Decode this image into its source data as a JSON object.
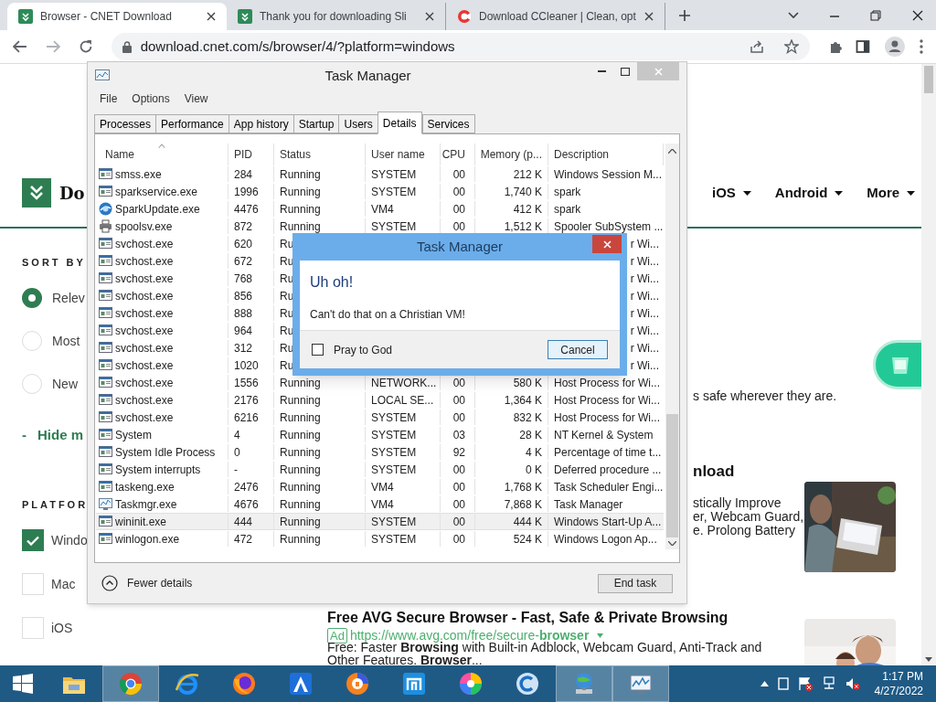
{
  "browser": {
    "tabs": [
      {
        "title": "Browser - CNET Download",
        "kind": "cnet",
        "selected": true
      },
      {
        "title": "Thank you for downloading Sli",
        "kind": "cnet",
        "selected": false
      },
      {
        "title": "Download CCleaner | Clean, opt",
        "kind": "ccleaner",
        "selected": false
      }
    ],
    "url": "download.cnet.com/s/browser/4/?platform=windows"
  },
  "page": {
    "logo_text": "Do",
    "nav": [
      "iOS",
      "Android",
      "More"
    ],
    "sort_by": {
      "heading": "SORT BY",
      "options": [
        {
          "label": "Relev",
          "selected": true
        },
        {
          "label": "Most",
          "selected": false
        },
        {
          "label": "New",
          "selected": false
        }
      ]
    },
    "toggle": {
      "sign": "-",
      "label": "Hide m"
    },
    "platform": {
      "heading": "PLATFOR",
      "options": [
        {
          "label": "Windo",
          "checked": true
        },
        {
          "label": "Mac",
          "checked": false
        },
        {
          "label": "iOS",
          "checked": false
        }
      ]
    },
    "intro_tail": "s safe wherever they are.",
    "result_1": {
      "title": "nload",
      "lines": [
        "stically Improve",
        "er, Webcam Guard,",
        "e. Prolong Battery"
      ]
    },
    "result_2": {
      "title": "Free AVG Secure Browser - Fast, Safe & Private Browsing",
      "ad_label": "Ad",
      "url": "https://www.avg.com/free/secure-**browser**",
      "description": "Free: Faster **Browsing** with Built-in Adblock, Webcam Guard, Anti-Track and Other Features. **Browser**..."
    }
  },
  "task_manager": {
    "title": "Task Manager",
    "menu": [
      "File",
      "Options",
      "View"
    ],
    "tabs": [
      {
        "label": "Processes",
        "selected": false
      },
      {
        "label": "Performance",
        "selected": false
      },
      {
        "label": "App history",
        "selected": false
      },
      {
        "label": "Startup",
        "selected": false
      },
      {
        "label": "Users",
        "selected": false
      },
      {
        "label": "Details",
        "selected": true
      },
      {
        "label": "Services",
        "selected": false
      }
    ],
    "columns": [
      {
        "label": "Name",
        "sorted": true
      },
      {
        "label": "PID",
        "sorted": false
      },
      {
        "label": "Status",
        "sorted": false
      },
      {
        "label": "User name",
        "sorted": false
      },
      {
        "label": "CPU",
        "sorted": false
      },
      {
        "label": "Memory (p...",
        "sorted": false
      },
      {
        "label": "Description",
        "sorted": false
      }
    ],
    "rows": [
      {
        "kind": "app",
        "name": "smss.exe",
        "pid": "284",
        "status": "Running",
        "user": "SYSTEM",
        "cpu": "00",
        "memory": "212 K",
        "description": "Windows Session M...",
        "selected": false
      },
      {
        "kind": "app",
        "name": "sparkservice.exe",
        "pid": "1996",
        "status": "Running",
        "user": "SYSTEM",
        "cpu": "00",
        "memory": "1,740 K",
        "description": "spark",
        "selected": false
      },
      {
        "kind": "update",
        "name": "SparkUpdate.exe",
        "pid": "4476",
        "status": "Running",
        "user": "VM4",
        "cpu": "00",
        "memory": "412 K",
        "description": "spark",
        "selected": false
      },
      {
        "kind": "printer",
        "name": "spoolsv.exe",
        "pid": "872",
        "status": "Running",
        "user": "SYSTEM",
        "cpu": "00",
        "memory": "1,512 K",
        "description": "Spooler SubSystem ...",
        "selected": false
      },
      {
        "kind": "app",
        "name": "svchost.exe",
        "pid": "620",
        "status": "Ru",
        "description": "r Wi...",
        "selected": false
      },
      {
        "kind": "app",
        "name": "svchost.exe",
        "pid": "672",
        "status": "Ru",
        "description": "r Wi...",
        "selected": false
      },
      {
        "kind": "app",
        "name": "svchost.exe",
        "pid": "768",
        "status": "Ru",
        "description": "r Wi...",
        "selected": false
      },
      {
        "kind": "app",
        "name": "svchost.exe",
        "pid": "856",
        "status": "Ru",
        "description": "r Wi...",
        "selected": false
      },
      {
        "kind": "app",
        "name": "svchost.exe",
        "pid": "888",
        "status": "Ru",
        "description": "r Wi...",
        "selected": false
      },
      {
        "kind": "app",
        "name": "svchost.exe",
        "pid": "964",
        "status": "Ru",
        "description": "r Wi...",
        "selected": false
      },
      {
        "kind": "app",
        "name": "svchost.exe",
        "pid": "312",
        "status": "Ru",
        "description": "r Wi...",
        "selected": false
      },
      {
        "kind": "app",
        "name": "svchost.exe",
        "pid": "1020",
        "status": "Ru",
        "description": "r Wi...",
        "selected": false
      },
      {
        "kind": "app",
        "name": "svchost.exe",
        "pid": "1556",
        "status": "Running",
        "user": "NETWORK...",
        "cpu": "00",
        "memory": "580 K",
        "description": "Host Process for Wi...",
        "selected": false
      },
      {
        "kind": "app",
        "name": "svchost.exe",
        "pid": "2176",
        "status": "Running",
        "user": "LOCAL SE...",
        "cpu": "00",
        "memory": "1,364 K",
        "description": "Host Process for Wi...",
        "selected": false
      },
      {
        "kind": "app",
        "name": "svchost.exe",
        "pid": "6216",
        "status": "Running",
        "user": "SYSTEM",
        "cpu": "00",
        "memory": "832 K",
        "description": "Host Process for Wi...",
        "selected": false
      },
      {
        "kind": "app",
        "name": "System",
        "pid": "4",
        "status": "Running",
        "user": "SYSTEM",
        "cpu": "03",
        "memory": "28 K",
        "description": "NT Kernel & System",
        "selected": false
      },
      {
        "kind": "app",
        "name": "System Idle Process",
        "pid": "0",
        "status": "Running",
        "user": "SYSTEM",
        "cpu": "92",
        "memory": "4 K",
        "description": "Percentage of time t...",
        "selected": false
      },
      {
        "kind": "app",
        "name": "System interrupts",
        "pid": "-",
        "status": "Running",
        "user": "SYSTEM",
        "cpu": "00",
        "memory": "0 K",
        "description": "Deferred procedure ...",
        "selected": false
      },
      {
        "kind": "app",
        "name": "taskeng.exe",
        "pid": "2476",
        "status": "Running",
        "user": "VM4",
        "cpu": "00",
        "memory": "1,768 K",
        "description": "Task Scheduler Engi...",
        "selected": false
      },
      {
        "kind": "monitor",
        "name": "Taskmgr.exe",
        "pid": "4676",
        "status": "Running",
        "user": "VM4",
        "cpu": "00",
        "memory": "7,868 K",
        "description": "Task Manager",
        "selected": false
      },
      {
        "kind": "app",
        "name": "wininit.exe",
        "pid": "444",
        "status": "Running",
        "user": "SYSTEM",
        "cpu": "00",
        "memory": "444 K",
        "description": "Windows Start-Up A...",
        "selected": true
      },
      {
        "kind": "app",
        "name": "winlogon.exe",
        "pid": "472",
        "status": "Running",
        "user": "SYSTEM",
        "cpu": "00",
        "memory": "524 K",
        "description": "Windows Logon Ap...",
        "selected": false
      }
    ],
    "fewer_details": "Fewer details",
    "end_task": "End task"
  },
  "dialog": {
    "title": "Task Manager",
    "heading": "Uh oh!",
    "message": "Can't do that on a Christian VM!",
    "checkbox": {
      "label": "Pray to God",
      "checked": false
    },
    "button": "Cancel"
  },
  "taskbar": {
    "apps": [
      {
        "kind": "folder",
        "active": false
      },
      {
        "kind": "ring",
        "active": true
      },
      {
        "kind": "e",
        "active": false
      },
      {
        "kind": "fox",
        "active": false
      },
      {
        "kind": "a",
        "active": false
      },
      {
        "kind": "shield",
        "active": false
      },
      {
        "kind": "m",
        "active": false
      },
      {
        "kind": "swirl",
        "active": false
      },
      {
        "kind": "c",
        "active": false
      },
      {
        "kind": "globe",
        "active": true
      },
      {
        "kind": "monitor",
        "active": true
      }
    ],
    "time": "1:17 PM",
    "date": "4/27/2022"
  }
}
